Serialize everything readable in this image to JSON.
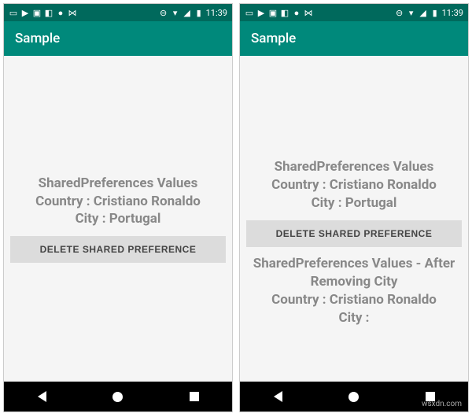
{
  "status": {
    "time": "11:39"
  },
  "left_phone": {
    "app_title": "Sample",
    "text_lines": {
      "l1": "SharedPreferences Values",
      "l2": "Country : Cristiano Ronaldo",
      "l3": "City : Portugal"
    },
    "button_label": "DELETE SHARED PREFERENCE"
  },
  "right_phone": {
    "app_title": "Sample",
    "text_lines": {
      "l1": "SharedPreferences Values",
      "l2": "Country : Cristiano Ronaldo",
      "l3": "City : Portugal"
    },
    "button_label": "DELETE SHARED PREFERENCE",
    "after_lines": {
      "l1": "SharedPreferences Values - After",
      "l2": "Removing City",
      "l3": "Country : Cristiano Ronaldo",
      "l4": "City :"
    }
  },
  "watermark": "wsxdn.com"
}
